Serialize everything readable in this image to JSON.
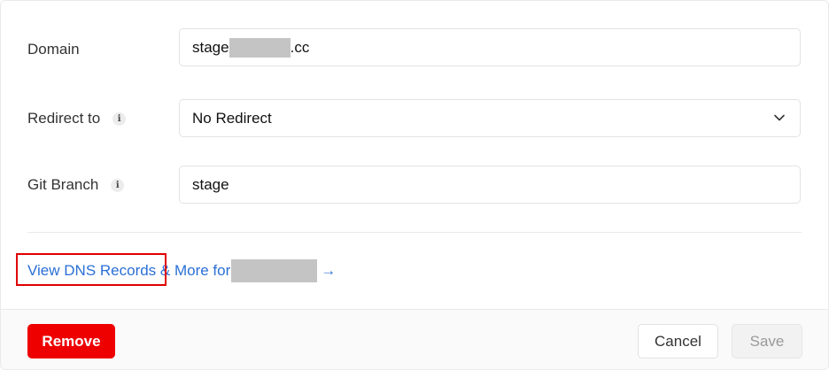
{
  "form": {
    "domain": {
      "label": "Domain",
      "value_prefix": "stage",
      "value_suffix": ".cc"
    },
    "redirect": {
      "label": "Redirect to",
      "value": "No Redirect"
    },
    "git_branch": {
      "label": "Git Branch",
      "value": "stage"
    },
    "info_icon_glyph": "i"
  },
  "dns_link": {
    "text_part1": "View DNS Records",
    "text_part2": " & More for",
    "arrow": "→"
  },
  "footer": {
    "remove_label": "Remove",
    "cancel_label": "Cancel",
    "save_label": "Save"
  },
  "colors": {
    "remove": "#ee0000",
    "link": "#2a6fd6",
    "highlight": "#e00000"
  }
}
